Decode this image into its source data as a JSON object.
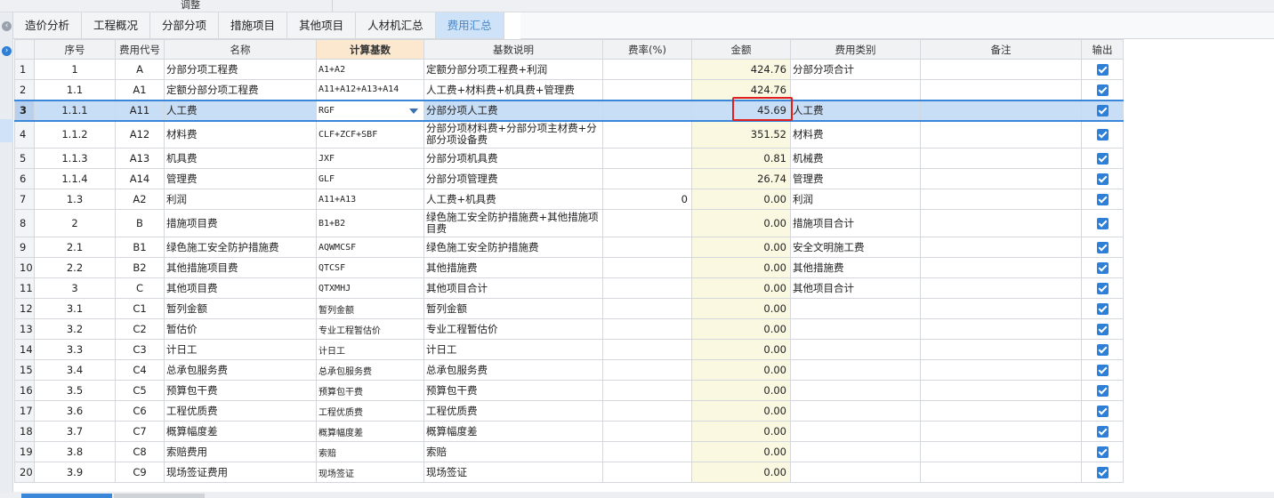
{
  "header": {
    "title": "调整"
  },
  "tabs": [
    {
      "label": "造价分析",
      "active": false
    },
    {
      "label": "工程概况",
      "active": false
    },
    {
      "label": "分部分项",
      "active": false
    },
    {
      "label": "措施项目",
      "active": false
    },
    {
      "label": "其他项目",
      "active": false
    },
    {
      "label": "人材机汇总",
      "active": false
    },
    {
      "label": "费用汇总",
      "active": true
    }
  ],
  "columns": [
    "序号",
    "费用代号",
    "名称",
    "计算基数",
    "基数说明",
    "费率(%)",
    "金额",
    "费用类别",
    "备注",
    "输出"
  ],
  "rows": [
    {
      "idx": "1",
      "seq": "1",
      "code": "A",
      "name": "分部分项工程费",
      "base": "A1+A2",
      "desc": "定额分部分项工程费+利润",
      "rate": "",
      "amount": "424.76",
      "category": "分部分项合计",
      "note": "",
      "output": true
    },
    {
      "idx": "2",
      "seq": "1.1",
      "code": "A1",
      "name": "定额分部分项工程费",
      "base": "A11+A12+A13+A14",
      "desc": "人工费+材料费+机具费+管理费",
      "rate": "",
      "amount": "424.76",
      "category": "",
      "note": "",
      "output": true
    },
    {
      "idx": "3",
      "seq": "1.1.1",
      "code": "A11",
      "name": "人工费",
      "base": "RGF",
      "desc": "分部分项人工费",
      "rate": "",
      "amount": "45.69",
      "category": "人工费",
      "note": "",
      "output": true
    },
    {
      "idx": "4",
      "seq": "1.1.2",
      "code": "A12",
      "name": "材料费",
      "base": "CLF+ZCF+SBF",
      "desc": "分部分项材料费+分部分项主材费+分部分项设备费",
      "rate": "",
      "amount": "351.52",
      "category": "材料费",
      "note": "",
      "output": true
    },
    {
      "idx": "5",
      "seq": "1.1.3",
      "code": "A13",
      "name": "机具费",
      "base": "JXF",
      "desc": "分部分项机具费",
      "rate": "",
      "amount": "0.81",
      "category": "机械费",
      "note": "",
      "output": true
    },
    {
      "idx": "6",
      "seq": "1.1.4",
      "code": "A14",
      "name": "管理费",
      "base": "GLF",
      "desc": "分部分项管理费",
      "rate": "",
      "amount": "26.74",
      "category": "管理费",
      "note": "",
      "output": true
    },
    {
      "idx": "7",
      "seq": "1.3",
      "code": "A2",
      "name": "利润",
      "base": "A11+A13",
      "desc": "人工费+机具费",
      "rate": "0",
      "amount": "0.00",
      "category": "利润",
      "note": "",
      "output": true
    },
    {
      "idx": "8",
      "seq": "2",
      "code": "B",
      "name": "措施项目费",
      "base": "B1+B2",
      "desc": "绿色施工安全防护措施费+其他措施项目费",
      "rate": "",
      "amount": "0.00",
      "category": "措施项目合计",
      "note": "",
      "output": true
    },
    {
      "idx": "9",
      "seq": "2.1",
      "code": "B1",
      "name": "绿色施工安全防护措施费",
      "base": "AQWMCSF",
      "desc": "绿色施工安全防护措施费",
      "rate": "",
      "amount": "0.00",
      "category": "安全文明施工费",
      "note": "",
      "output": true
    },
    {
      "idx": "10",
      "seq": "2.2",
      "code": "B2",
      "name": "其他措施项目费",
      "base": "QTCSF",
      "desc": "其他措施费",
      "rate": "",
      "amount": "0.00",
      "category": "其他措施费",
      "note": "",
      "output": true
    },
    {
      "idx": "11",
      "seq": "3",
      "code": "C",
      "name": "其他项目费",
      "base": "QTXMHJ",
      "desc": "其他项目合计",
      "rate": "",
      "amount": "0.00",
      "category": "其他项目合计",
      "note": "",
      "output": true
    },
    {
      "idx": "12",
      "seq": "3.1",
      "code": "C1",
      "name": "暂列金额",
      "base": "暂列金额",
      "desc": "暂列金额",
      "rate": "",
      "amount": "0.00",
      "category": "",
      "note": "",
      "output": true
    },
    {
      "idx": "13",
      "seq": "3.2",
      "code": "C2",
      "name": "暂估价",
      "base": "专业工程暂估价",
      "desc": "专业工程暂估价",
      "rate": "",
      "amount": "0.00",
      "category": "",
      "note": "",
      "output": true
    },
    {
      "idx": "14",
      "seq": "3.3",
      "code": "C3",
      "name": "计日工",
      "base": "计日工",
      "desc": "计日工",
      "rate": "",
      "amount": "0.00",
      "category": "",
      "note": "",
      "output": true
    },
    {
      "idx": "15",
      "seq": "3.4",
      "code": "C4",
      "name": "总承包服务费",
      "base": "总承包服务费",
      "desc": "总承包服务费",
      "rate": "",
      "amount": "0.00",
      "category": "",
      "note": "",
      "output": true
    },
    {
      "idx": "16",
      "seq": "3.5",
      "code": "C5",
      "name": "预算包干费",
      "base": "预算包干费",
      "desc": "预算包干费",
      "rate": "",
      "amount": "0.00",
      "category": "",
      "note": "",
      "output": true
    },
    {
      "idx": "17",
      "seq": "3.6",
      "code": "C6",
      "name": "工程优质费",
      "base": "工程优质费",
      "desc": "工程优质费",
      "rate": "",
      "amount": "0.00",
      "category": "",
      "note": "",
      "output": true
    },
    {
      "idx": "18",
      "seq": "3.7",
      "code": "C7",
      "name": "概算幅度差",
      "base": "概算幅度差",
      "desc": "概算幅度差",
      "rate": "",
      "amount": "0.00",
      "category": "",
      "note": "",
      "output": true
    },
    {
      "idx": "19",
      "seq": "3.8",
      "code": "C8",
      "name": "索赔费用",
      "base": "索赔",
      "desc": "索赔",
      "rate": "",
      "amount": "0.00",
      "category": "",
      "note": "",
      "output": true
    },
    {
      "idx": "20",
      "seq": "3.9",
      "code": "C9",
      "name": "现场签证费用",
      "base": "现场签证",
      "desc": "现场签证",
      "rate": "",
      "amount": "0.00",
      "category": "",
      "note": "",
      "output": true
    }
  ]
}
